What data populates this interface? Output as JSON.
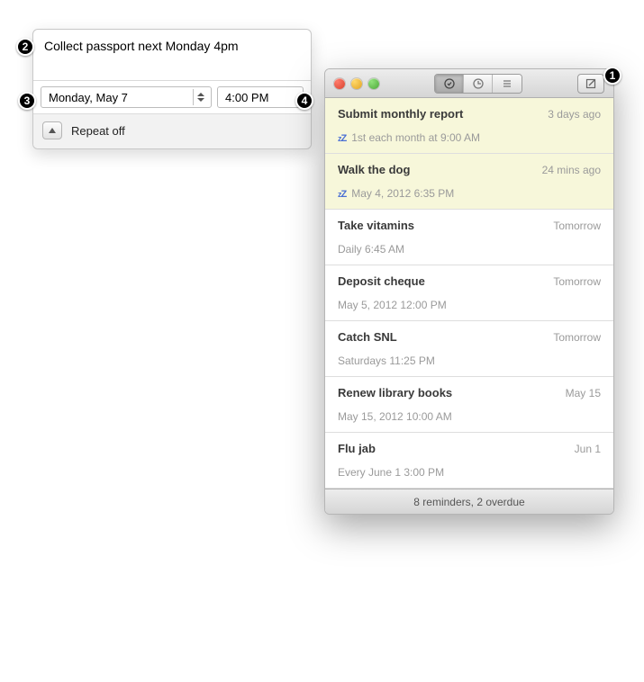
{
  "popover": {
    "title": "Collect passport next Monday 4pm",
    "date": "Monday, May 7",
    "time": "4:00 PM",
    "repeat_label": "Repeat off"
  },
  "window": {
    "status": "8 reminders, 2 overdue"
  },
  "reminders": [
    {
      "title": "Submit monthly report",
      "due": "3 days ago",
      "sub": "1st each month at 9:00 AM",
      "overdue": true,
      "snoozed": true
    },
    {
      "title": "Walk the dog",
      "due": "24 mins ago",
      "sub": "May 4, 2012 6:35 PM",
      "overdue": true,
      "snoozed": true
    },
    {
      "title": "Take vitamins",
      "due": "Tomorrow",
      "sub": "Daily 6:45 AM",
      "overdue": false,
      "snoozed": false
    },
    {
      "title": "Deposit cheque",
      "due": "Tomorrow",
      "sub": "May 5, 2012 12:00 PM",
      "overdue": false,
      "snoozed": false
    },
    {
      "title": "Catch SNL",
      "due": "Tomorrow",
      "sub": "Saturdays 11:25 PM",
      "overdue": false,
      "snoozed": false
    },
    {
      "title": "Renew library books",
      "due": "May 15",
      "sub": "May 15, 2012 10:00 AM",
      "overdue": false,
      "snoozed": false
    },
    {
      "title": "Flu jab",
      "due": "Jun 1",
      "sub": "Every June 1 3:00 PM",
      "overdue": false,
      "snoozed": false
    }
  ],
  "badges": {
    "b1": "1",
    "b2": "2",
    "b3": "3",
    "b4": "4"
  }
}
